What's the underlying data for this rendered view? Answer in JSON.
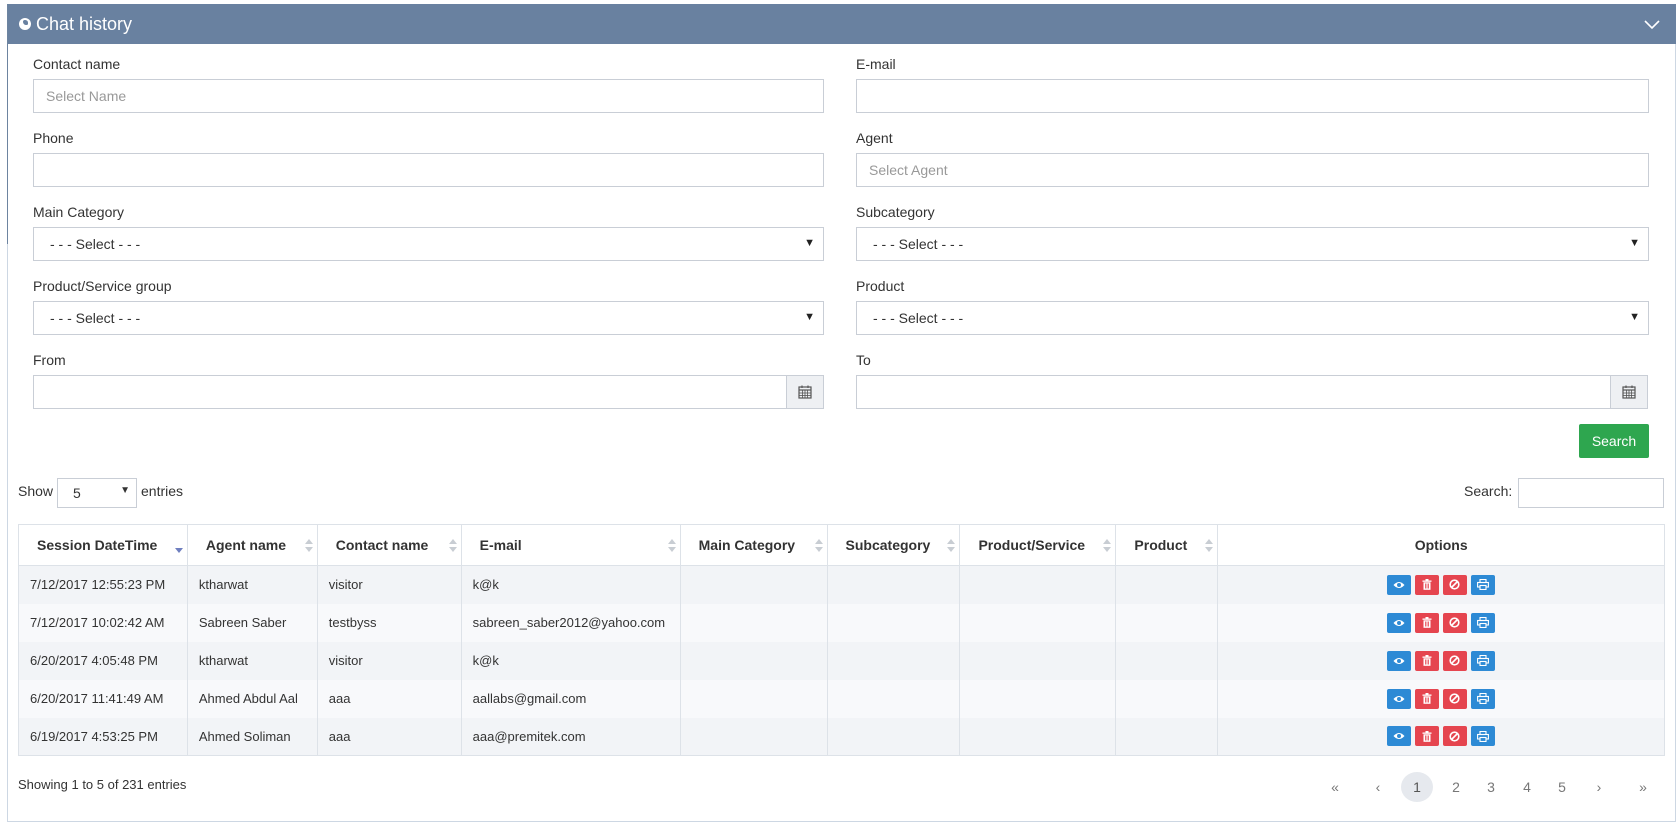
{
  "panel": {
    "title": "Chat history"
  },
  "form": {
    "contact_name_label": "Contact name",
    "contact_name_placeholder": "Select Name",
    "email_label": "E-mail",
    "phone_label": "Phone",
    "agent_label": "Agent",
    "agent_placeholder": "Select Agent",
    "main_category_label": "Main Category",
    "main_category_value": "- - - Select - - -",
    "subcategory_label": "Subcategory",
    "subcategory_value": "- - - Select - - -",
    "product_group_label": "Product/Service group",
    "product_group_value": "- - - Select - - -",
    "product_label": "Product",
    "product_value": "- - - Select - - -",
    "from_label": "From",
    "to_label": "To",
    "search_button": "Search"
  },
  "table_controls": {
    "show_label": "Show",
    "entries_label": "entries",
    "page_length": "5",
    "search_label": "Search:"
  },
  "table": {
    "headers": [
      "Session DateTime",
      "Agent name",
      "Contact name",
      "E-mail",
      "Main Category",
      "Subcategory",
      "Product/Service",
      "Product",
      "Options"
    ],
    "sorted_column": "Session DateTime",
    "sort_direction": "descending",
    "rows": [
      [
        "7/12/2017 12:55:23 PM",
        "ktharwat",
        "visitor",
        "k@k",
        "",
        "",
        "",
        ""
      ],
      [
        "7/12/2017 10:02:42 AM",
        "Sabreen Saber",
        "testbyss",
        "sabreen_saber2012@yahoo.com",
        "",
        "",
        "",
        ""
      ],
      [
        "6/20/2017 4:05:48 PM",
        "ktharwat",
        "visitor",
        "k@k",
        "",
        "",
        "",
        ""
      ],
      [
        "6/20/2017 11:41:49 AM",
        "Ahmed Abdul Aal",
        "aaa",
        "aallabs@gmail.com",
        "",
        "",
        "",
        ""
      ],
      [
        "6/19/2017 4:53:25 PM",
        "Ahmed Soliman",
        "aaa",
        "aaa@premitek.com",
        "",
        "",
        "",
        ""
      ]
    ],
    "row_actions": [
      "eye-icon",
      "trash-icon",
      "ban-icon",
      "print-icon"
    ]
  },
  "footer": {
    "info": "Showing 1 to 5 of 231 entries",
    "first": "«",
    "prev": "‹",
    "pages": [
      "1",
      "2",
      "3",
      "4",
      "5"
    ],
    "active_page": "1",
    "next": "›",
    "last": "»"
  },
  "colors": {
    "header_bg": "#6981a0",
    "search_button": "#2ea64f",
    "view_button": "#2d8ad5",
    "delete_button": "#e5454f"
  }
}
